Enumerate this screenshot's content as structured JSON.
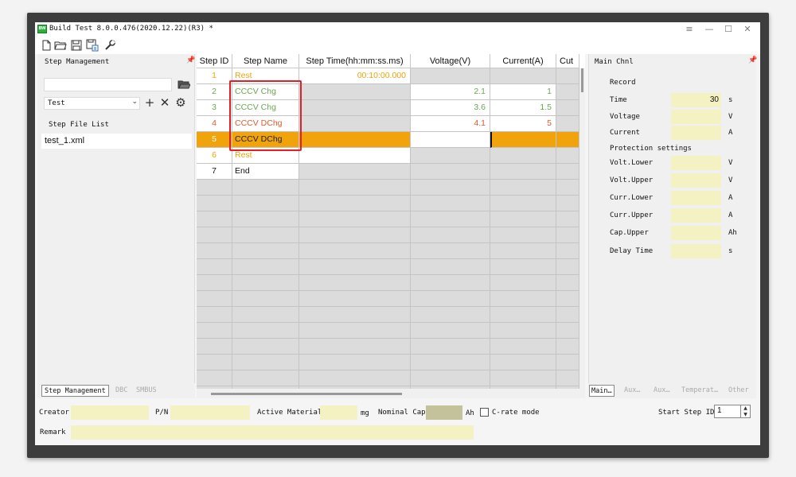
{
  "window": {
    "title": "Build Test 8.0.0.476(2020.12.22)(R3) *",
    "app_icon_label": "BW",
    "controls": {
      "menu": "≡",
      "minimize": "—",
      "maximize": "☐",
      "close": "✕"
    }
  },
  "toolbar": {
    "icons": [
      "new-file-icon",
      "open-folder-icon",
      "save-icon",
      "save-as-icon",
      "wrench-icon"
    ]
  },
  "step_management": {
    "title": "Step Management",
    "path_value": "",
    "combo_value": "Test",
    "file_list_label": "Step File List",
    "files": [
      "test_1.xml"
    ],
    "tabs": [
      "Step Management",
      "DBC",
      "SMBUS"
    ]
  },
  "grid": {
    "columns": [
      "Step ID",
      "Step Name",
      "Step Time(hh:mm:ss.ms)",
      "Voltage(V)",
      "Current(A)",
      "Cut"
    ],
    "rows": [
      {
        "id": "1",
        "name": "Rest",
        "time": "00:10:00.000",
        "voltage": "",
        "current": "",
        "type": "rest"
      },
      {
        "id": "2",
        "name": "CCCV Chg",
        "time": "",
        "voltage": "2.1",
        "current": "1",
        "type": "chg"
      },
      {
        "id": "3",
        "name": "CCCV Chg",
        "time": "",
        "voltage": "3.6",
        "current": "1.5",
        "type": "chg"
      },
      {
        "id": "4",
        "name": "CCCV DChg",
        "time": "",
        "voltage": "4.1",
        "current": "5",
        "type": "dchg"
      },
      {
        "id": "5",
        "name": "CCCV DChg",
        "time": "",
        "voltage": "",
        "current": "",
        "type": "selected"
      },
      {
        "id": "6",
        "name": "Rest",
        "time": "",
        "voltage": "",
        "current": "",
        "type": "rest"
      },
      {
        "id": "7",
        "name": "End",
        "time": "",
        "voltage": "",
        "current": "",
        "type": "end"
      }
    ],
    "colors": {
      "rest": "#f0a30a",
      "chg": "#6aa84f",
      "dchg": "#e25b2b",
      "selected_bg": "#f0a30a",
      "highlight": "#e31e24"
    }
  },
  "main_chnl": {
    "title": "Main Chnl",
    "record_label": "Record",
    "fields": [
      {
        "label": "Time",
        "value": "30",
        "unit": "s"
      },
      {
        "label": "Voltage",
        "value": "",
        "unit": "V"
      },
      {
        "label": "Current",
        "value": "",
        "unit": "A"
      }
    ],
    "protection_label": "Protection settings",
    "protection_fields": [
      {
        "label": "Volt.Lower",
        "value": "",
        "unit": "V"
      },
      {
        "label": "Volt.Upper",
        "value": "",
        "unit": "V"
      },
      {
        "label": "Curr.Lower",
        "value": "",
        "unit": "A"
      },
      {
        "label": "Curr.Upper",
        "value": "",
        "unit": "A"
      },
      {
        "label": "Cap.Upper",
        "value": "",
        "unit": "Ah"
      },
      {
        "label": "Delay Time",
        "value": "",
        "unit": "s"
      }
    ],
    "tabs": [
      "Main…",
      "Aux…",
      "Aux…",
      "Temperat…",
      "Other"
    ]
  },
  "bottom": {
    "creator_label": "Creator",
    "creator_value": "",
    "pn_label": "P/N",
    "pn_value": "",
    "active_material_label": "Active Material",
    "active_material_unit": "mg",
    "nominal_cap_label": "Nominal Cap",
    "nominal_cap_unit": "Ah",
    "crate_label": "C-rate mode",
    "start_step_label": "Start Step ID",
    "start_step_value": "1",
    "remark_label": "Remark",
    "remark_value": ""
  }
}
